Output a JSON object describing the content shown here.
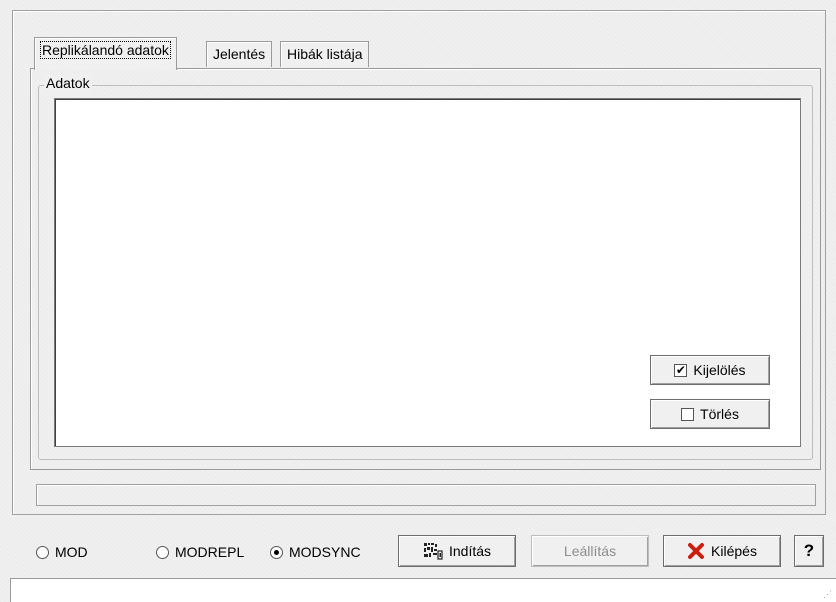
{
  "tabs": [
    {
      "label": "Replikálandó adatok",
      "active": true
    },
    {
      "label": "Jelentés",
      "active": false
    },
    {
      "label": "Hibák listája",
      "active": false
    }
  ],
  "group": {
    "title": "Adatok"
  },
  "side_buttons": {
    "select_label": "Kijelölés",
    "select_checked": true,
    "delete_label": "Törlés",
    "delete_checked": false
  },
  "mode_options": [
    {
      "label": "MOD",
      "selected": false
    },
    {
      "label": "MODREPL",
      "selected": false
    },
    {
      "label": "MODSYNC",
      "selected": true
    }
  ],
  "actions": {
    "start_label": "Indítás",
    "stop_label": "Leállítás",
    "exit_label": "Kilépés",
    "help_label": "?"
  },
  "colors": {
    "exit_icon": "#cc1e10"
  },
  "icons": {
    "start": "barcode-icon",
    "exit": "red-x-icon",
    "check": "checkmark-icon"
  }
}
